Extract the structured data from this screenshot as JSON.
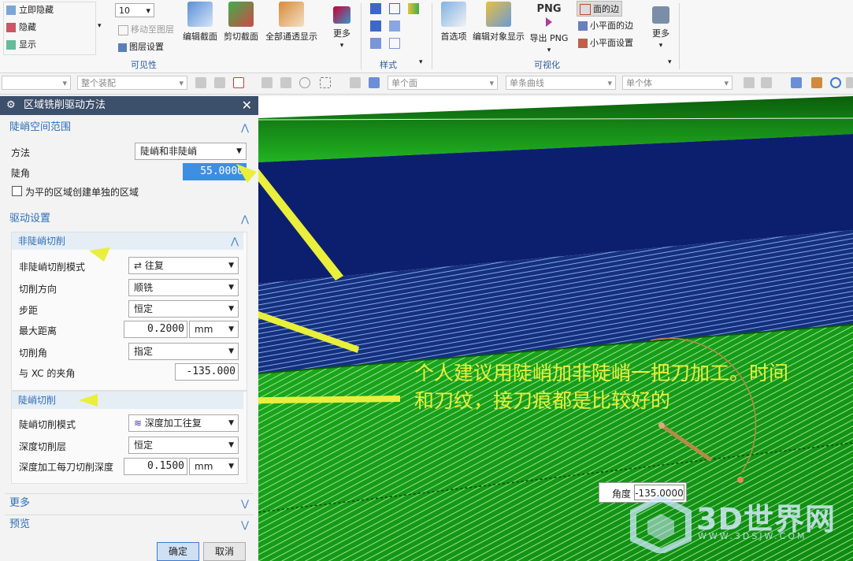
{
  "ribbon": {
    "visibility_items": [
      "立即隐藏",
      "隐藏",
      "显示"
    ],
    "layer_combo_value": "10",
    "move_to_layer": "移动至图层",
    "layer_settings": "图层设置",
    "group_visibility": "可见性",
    "edit_section": "编辑截面",
    "clip_section": "剪切截面",
    "full_pass_display": "全部通透显示",
    "more1": "更多",
    "group_style": "样式",
    "preferences": "首选项",
    "edit_object_display": "编辑对象显示",
    "export_png": "导出 PNG",
    "png_label": "PNG",
    "face_edges": "面的边",
    "facet_edges": "小平面的边",
    "facet_settings": "小平面设置",
    "more2": "更多",
    "group_visualize": "可视化"
  },
  "toolbar": {
    "assembly_filter": "整个装配",
    "face_filter": "单个面",
    "curve_filter": "单条曲线",
    "body_filter": "单个体"
  },
  "dialog": {
    "title": "区域铣削驱动方法",
    "steep_section": {
      "title": "陡峭空间范围",
      "method_label": "方法",
      "method_value": "陡峭和非陡峭",
      "steep_angle_label": "陡角",
      "steep_angle_value": "55.0000",
      "separate_flat_label": "为平的区域创建单独的区域"
    },
    "drive_section": {
      "title": "驱动设置",
      "nonsteep": {
        "title": "非陡峭切削",
        "mode_label": "非陡峭切削模式",
        "mode_value": "往复",
        "direction_label": "切削方向",
        "direction_value": "顺铣",
        "stepover_label": "步距",
        "stepover_value": "恒定",
        "max_distance_label": "最大距离",
        "max_distance_value": "0.2000",
        "max_distance_unit": "mm",
        "cut_angle_label": "切削角",
        "cut_angle_value": "指定",
        "xc_angle_label": "与 XC 的夹角",
        "xc_angle_value": "-135.000"
      },
      "steep": {
        "title": "陡峭切削",
        "mode_label": "陡峭切削模式",
        "mode_value": "深度加工往复",
        "depth_layers_label": "深度切削层",
        "depth_layers_value": "恒定",
        "depth_per_cut_label": "深度加工每刀切削深度",
        "depth_per_cut_value": "0.1500",
        "depth_per_cut_unit": "mm"
      }
    },
    "more_title": "更多",
    "preview_title": "预览",
    "ok_label": "确定",
    "cancel_label": "取消"
  },
  "viewport": {
    "annotation_line1": "个人建议用陡峭加非陡峭一把刀加工。时间",
    "annotation_line2": "和刀纹，接刀痕都是比较好的",
    "angle_label": "角度",
    "angle_value": "-135.0000",
    "watermark_title": "3D世界网",
    "watermark_url": "WWW.3DSJW.COM"
  },
  "colors": {
    "title_bar": "#3c4f6b",
    "section_blue": "#2f6fb6",
    "deep_navy": "#0c1f6e",
    "part_green": "#1ea51e",
    "annotation_yellow": "#e9ef3a"
  }
}
